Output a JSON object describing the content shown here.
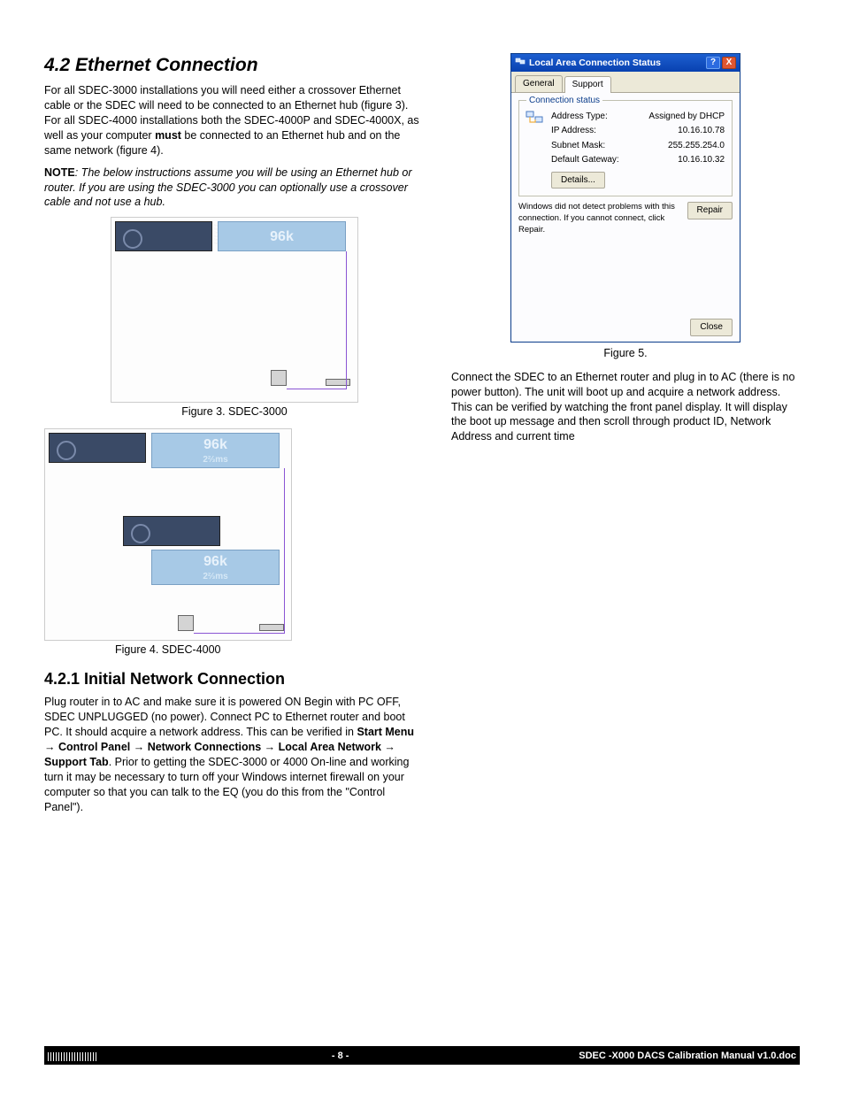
{
  "section": {
    "number_title": "4.2  Ethernet Connection",
    "p1_a": "For all SDEC-3000 installations you will need either a crossover Ethernet cable or the SDEC will need to be connected to an Ethernet hub (figure 3). For all SDEC-4000 installations both the SDEC-4000P and SDEC-4000X, as well as your computer ",
    "p1_bold": "must",
    "p1_b": " be connected to an Ethernet hub and on the same network (figure 4).",
    "note_label": "NOTE",
    "note_text": ": The below instructions assume you will be using an Ethernet hub or router. If you are using the SDEC-3000 you can optionally use a crossover cable and not use a hub."
  },
  "fig3": {
    "caption": "Figure 3. SDEC-3000",
    "screen_main": "96k"
  },
  "fig4": {
    "caption": "Figure 4. SDEC-4000",
    "screen_main": "96k",
    "screen_sub": "2⅔ms"
  },
  "subsection": {
    "title": "4.2.1 Initial Network Connection",
    "p_a": "Plug router in to AC and make sure it is powered ON Begin with PC OFF, SDEC UNPLUGGED (no power). Connect PC to Ethernet router and boot PC. It should acquire a network address. This can be verified in ",
    "menu1": "Start Menu",
    "arrow": " → ",
    "menu2": "Control Panel",
    "menu3": "Network Connections",
    "menu4": "Local Area Network",
    "menu5": "Support Tab",
    "p_b": ". Prior to getting the SDEC-3000 or 4000 On-line and working turn it may be necessary to turn off your Windows internet firewall on your computer so that you can talk to the EQ (you do this from the \"Control Panel\")."
  },
  "dialog": {
    "title": "Local Area Connection Status",
    "tab_general": "General",
    "tab_support": "Support",
    "fieldset_label": "Connection status",
    "rows": {
      "addr_type_lbl": "Address Type:",
      "addr_type_val": "Assigned by DHCP",
      "ip_lbl": "IP Address:",
      "ip_val": "10.16.10.78",
      "mask_lbl": "Subnet Mask:",
      "mask_val": "255.255.254.0",
      "gw_lbl": "Default Gateway:",
      "gw_val": "10.16.10.32"
    },
    "details_btn": "Details...",
    "status_msg": "Windows did not detect problems with this connection. If you cannot connect, click Repair.",
    "repair_btn": "Repair",
    "close_btn": "Close",
    "help_btn": "?",
    "x_btn": "X"
  },
  "fig5_caption": "Figure 5.",
  "right_para": "Connect the SDEC to an Ethernet router and plug in to AC (there is no power button). The unit will boot up and acquire a network address. This can be verified by watching the front panel display. It will display the boot up message and then scroll through product ID, Network Address and current time",
  "footer": {
    "page": "- 8 -",
    "doc": "SDEC -X000 DACS Calibration Manual v1.0.doc"
  }
}
